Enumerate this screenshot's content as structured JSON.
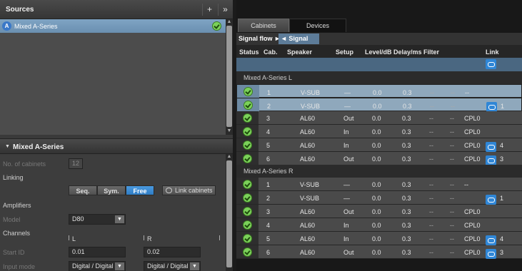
{
  "sources": {
    "title": "Sources",
    "add_label": "+",
    "expand_label": "»",
    "items": [
      {
        "badge": "A",
        "name": "Mixed A-Series",
        "status": "ok"
      }
    ]
  },
  "section": {
    "title": "Mixed A-Series",
    "no_cabinets_label": "No. of cabinets",
    "no_cabinets_value": "12",
    "linking_label": "Linking",
    "linking_options": [
      "Seq.",
      "Sym.",
      "Free"
    ],
    "linking_selected": "Free",
    "link_cabinets_label": "Link cabinets",
    "amplifiers_label": "Amplifiers",
    "model_label": "Model",
    "model_value": "D80",
    "channels_label": "Channels",
    "channel_L": "L",
    "channel_R": "R",
    "start_id_label": "Start ID",
    "start_id_L": "0.01",
    "start_id_R": "0.02",
    "input_mode_label": "Input mode",
    "input_mode_L": "Digital / Digital",
    "input_mode_R": "Digital / Digital"
  },
  "tabs": [
    "Cabinets",
    "Devices"
  ],
  "signal_flow": {
    "fwd_label": "Signal flow ►",
    "back_label": "◄ Signal flow"
  },
  "columns": [
    "Status",
    "Cab.",
    "Speaker",
    "Setup",
    "Level/dB",
    "Delay/ms",
    "Filter",
    "Link"
  ],
  "groups": [
    {
      "name": "Mixed A-Series  L",
      "rows": [
        {
          "cab": "1",
          "speaker": "V-SUB",
          "setup": "—",
          "level": "0.0",
          "delay": "0.3",
          "filter1": "--",
          "filter2": "--",
          "filter3": "--",
          "link": null,
          "selected": true
        },
        {
          "cab": "2",
          "speaker": "V-SUB",
          "setup": "—",
          "level": "0.0",
          "delay": "0.3",
          "filter1": "--",
          "filter2": "--",
          "filter3": "",
          "link": "1",
          "selected": true
        },
        {
          "cab": "3",
          "speaker": "AL60",
          "setup": "Out",
          "level": "0.0",
          "delay": "0.3",
          "filter1": "--",
          "filter2": "--",
          "filter3": "CPL0",
          "link": null,
          "selected": false
        },
        {
          "cab": "4",
          "speaker": "AL60",
          "setup": "In",
          "level": "0.0",
          "delay": "0.3",
          "filter1": "--",
          "filter2": "--",
          "filter3": "CPL0",
          "link": null,
          "selected": false
        },
        {
          "cab": "5",
          "speaker": "AL60",
          "setup": "In",
          "level": "0.0",
          "delay": "0.3",
          "filter1": "--",
          "filter2": "--",
          "filter3": "CPL0",
          "link": "4",
          "selected": false
        },
        {
          "cab": "6",
          "speaker": "AL60",
          "setup": "Out",
          "level": "0.0",
          "delay": "0.3",
          "filter1": "--",
          "filter2": "--",
          "filter3": "CPL0",
          "link": "3",
          "selected": false
        }
      ]
    },
    {
      "name": "Mixed A-Series  R",
      "rows": [
        {
          "cab": "1",
          "speaker": "V-SUB",
          "setup": "—",
          "level": "0.0",
          "delay": "0.3",
          "filter1": "--",
          "filter2": "--",
          "filter3": "--",
          "link": null,
          "selected": false
        },
        {
          "cab": "2",
          "speaker": "V-SUB",
          "setup": "—",
          "level": "0.0",
          "delay": "0.3",
          "filter1": "--",
          "filter2": "--",
          "filter3": "",
          "link": "1",
          "selected": false
        },
        {
          "cab": "3",
          "speaker": "AL60",
          "setup": "Out",
          "level": "0.0",
          "delay": "0.3",
          "filter1": "--",
          "filter2": "--",
          "filter3": "CPL0",
          "link": null,
          "selected": false
        },
        {
          "cab": "4",
          "speaker": "AL60",
          "setup": "In",
          "level": "0.0",
          "delay": "0.3",
          "filter1": "--",
          "filter2": "--",
          "filter3": "CPL0",
          "link": null,
          "selected": false
        },
        {
          "cab": "5",
          "speaker": "AL60",
          "setup": "In",
          "level": "0.0",
          "delay": "0.3",
          "filter1": "--",
          "filter2": "--",
          "filter3": "CPL0",
          "link": "4",
          "selected": false
        },
        {
          "cab": "6",
          "speaker": "AL60",
          "setup": "Out",
          "level": "0.0",
          "delay": "0.3",
          "filter1": "--",
          "filter2": "--",
          "filter3": "CPL0",
          "link": "3",
          "selected": false
        }
      ]
    }
  ],
  "colors": {
    "accent": "#2f86d6",
    "status_ok": "#7bd15a",
    "selected_row": "#8fa8bc"
  }
}
